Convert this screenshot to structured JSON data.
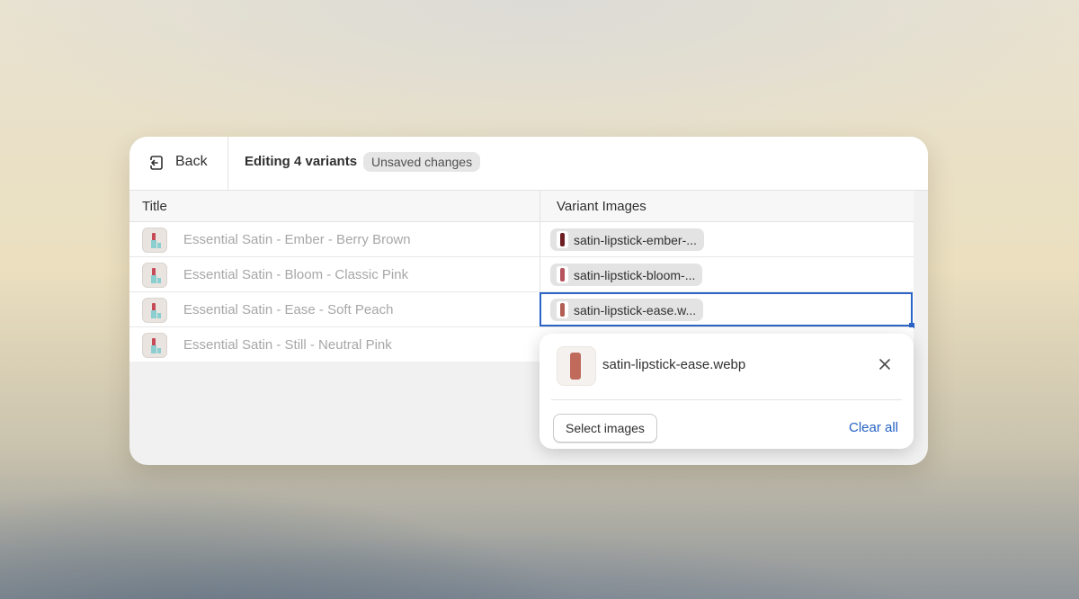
{
  "header": {
    "back_label": "Back",
    "title": "Editing 4 variants",
    "badge": "Unsaved changes"
  },
  "table": {
    "columns": [
      "Title",
      "Variant Images"
    ],
    "rows": [
      {
        "title": "Essential Satin - Ember - Berry Brown",
        "image": "satin-lipstick-ember-...",
        "swatch_color": "#6e1f24"
      },
      {
        "title": "Essential Satin - Bloom - Classic Pink",
        "image": "satin-lipstick-bloom-...",
        "swatch_color": "#b6535d"
      },
      {
        "title": "Essential Satin - Ease - Soft Peach",
        "image": "satin-lipstick-ease.w...",
        "swatch_color": "#b25e55"
      },
      {
        "title": "Essential Satin - Still - Neutral Pink",
        "image": "",
        "swatch_color": ""
      }
    ]
  },
  "popover": {
    "file_name": "satin-lipstick-ease.webp",
    "select_label": "Select images",
    "clear_label": "Clear all"
  },
  "colors": {
    "accent": "#2b63c6",
    "link": "#2563c4",
    "badge_bg": "#e6e6e6"
  }
}
